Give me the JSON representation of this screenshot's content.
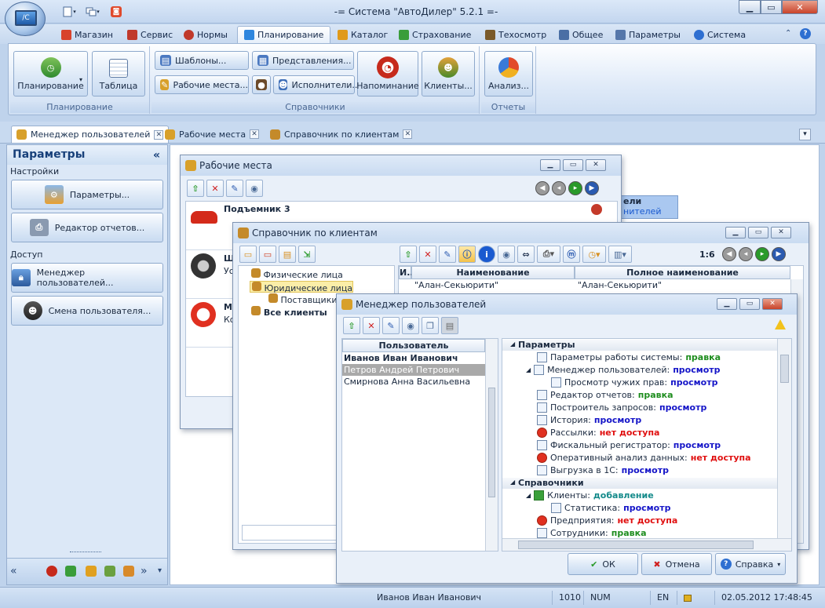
{
  "app": {
    "title": "-= Система \"АвтоДилер\" 5.2.1 =-"
  },
  "menu": {
    "tabs": [
      {
        "label": "Магазин",
        "color": "#d8432c"
      },
      {
        "label": "Сервис",
        "color": "#c0392b"
      },
      {
        "label": "Нормы",
        "color": "#c0392b"
      },
      {
        "label": "Планирование",
        "color": "#2e86de"
      },
      {
        "label": "Каталог",
        "color": "#e09a1a"
      },
      {
        "label": "Страхование",
        "color": "#3a9d3a"
      },
      {
        "label": "Техосмотр",
        "color": "#7a5a2a"
      },
      {
        "label": "Общее",
        "color": "#4a6fa5"
      },
      {
        "label": "Параметры",
        "color": "#5577aa"
      },
      {
        "label": "Система",
        "color": "#2e6fd1"
      }
    ]
  },
  "ribbon": {
    "planning": {
      "btn_planning": "Планирование",
      "btn_table": "Таблица",
      "group_label": "Планирование"
    },
    "refs": {
      "btn_templates": "Шаблоны...",
      "btn_views": "Представления...",
      "btn_workplaces": "Рабочие места...",
      "btn_executors": "Исполнители...",
      "btn_reminder": "Напоминание",
      "btn_clients": "Клиенты...",
      "group_label": "Справочники"
    },
    "reports": {
      "btn_analysis": "Анализ...",
      "group_label": "Отчеты"
    }
  },
  "doctabs": [
    {
      "label": "Менеджер пользователей"
    },
    {
      "label": "Рабочие места"
    },
    {
      "label": "Справочник по клиентам"
    }
  ],
  "sidebar": {
    "title": "Параметры",
    "section_settings": "Настройки",
    "btn_params": "Параметры...",
    "btn_report_editor": "Редактор отчетов...",
    "section_access": "Доступ",
    "btn_user_manager": "Менеджер пользователей...",
    "btn_change_user": "Смена пользователя..."
  },
  "workplaces": {
    "title": "Рабочие места",
    "items": [
      {
        "name": "Подъемник 3",
        "sub": ""
      },
      {
        "name": "Ш",
        "sub": "Ус"
      },
      {
        "name": "М",
        "sub": "Ко"
      }
    ],
    "behind_text1": "ели",
    "behind_text2": "нителей"
  },
  "clients": {
    "title": "Справочник по клиентам",
    "counter": "1:6",
    "tree": {
      "physical": "Физические лица",
      "legal": "Юридические лица",
      "suppliers": "Поставщики",
      "all": "Все клиенты"
    },
    "grid": {
      "col_i": "И..",
      "col_name": "Наименование",
      "col_fullname": "Полное наименование",
      "row1_name": "\"Алан-Секьюрити\"",
      "row1_fullname": "\"Алан-Секьюрити\""
    }
  },
  "usermgr": {
    "title": "Менеджер пользователей",
    "list_header": "Пользователь",
    "users": [
      {
        "name": "Иванов Иван Иванович"
      },
      {
        "name": "Петров Андрей Петрович"
      },
      {
        "name": "Смирнова Анна Васильевна"
      }
    ],
    "perms": {
      "sec_params": "Параметры",
      "p1_label": "Параметры работы системы:",
      "p1_value": "правка",
      "p2_label": "Менеджер пользователей:",
      "p2_value": "просмотр",
      "p3_label": "Просмотр чужих прав:",
      "p3_value": "просмотр",
      "p4_label": "Редактор отчетов:",
      "p4_value": "правка",
      "p5_label": "Построитель запросов:",
      "p5_value": "просмотр",
      "p6_label": "История:",
      "p6_value": "просмотр",
      "p7_label": "Рассылки:",
      "p7_value": "нет доступа",
      "p8_label": "Фискальный регистратор:",
      "p8_value": "просмотр",
      "p9_label": "Оперативный анализ данных:",
      "p9_value": "нет доступа",
      "p10_label": "Выгрузка в 1С:",
      "p10_value": "просмотр",
      "sec_refs": "Справочники",
      "r1_label": "Клиенты:",
      "r1_value": "добавление",
      "r2_label": "Статистика:",
      "r2_value": "просмотр",
      "r3_label": "Предприятия:",
      "r3_value": "нет доступа",
      "r4_label": "Сотрудники:",
      "r4_value": "правка"
    },
    "btn_ok": "ОК",
    "btn_cancel": "Отмена",
    "btn_help": "Справка"
  },
  "status": {
    "user": "Иванов Иван Иванович",
    "code": "1010",
    "num": "NUM",
    "lang": "EN",
    "datetime": "02.05.2012 17:48:45"
  }
}
